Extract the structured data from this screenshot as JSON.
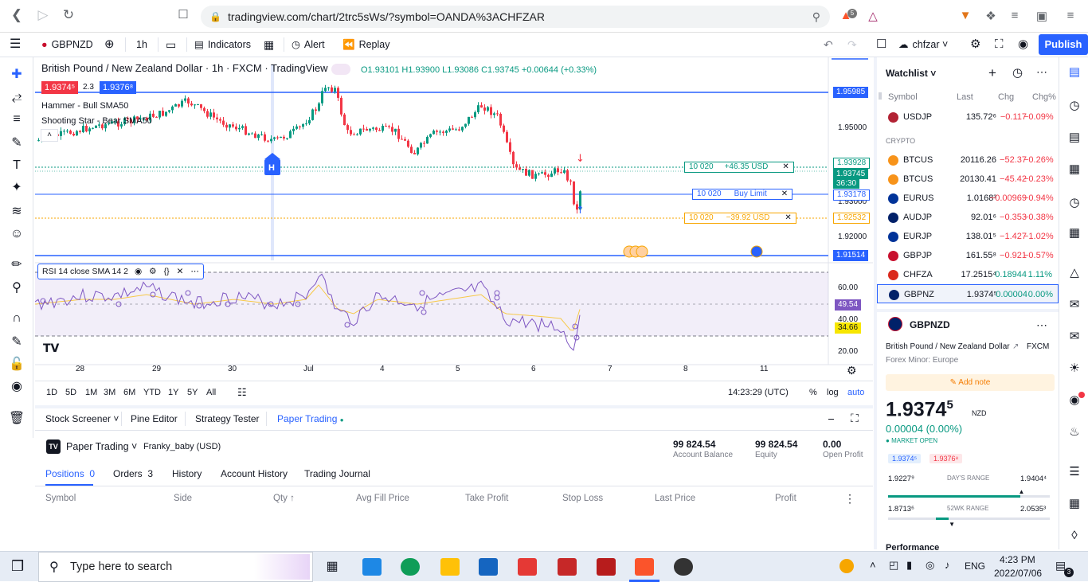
{
  "browser": {
    "url": "tradingview.com/chart/2trc5sWs/?symbol=OANDA%3ACHFZAR",
    "badge_count": "5"
  },
  "toolbar": {
    "symbol": "GBPNZD",
    "interval": "1h",
    "indicators": "Indicators",
    "alert": "Alert",
    "replay": "Replay",
    "layout_name": "chfzar",
    "publish": "Publish"
  },
  "chart": {
    "title": "British Pound / New Zealand Dollar · 1h · FXCM · TradingView",
    "ohlc": "O1.93101  H1.93900  L1.93086  C1.93745  +0.00644 (+0.33%)",
    "bid": "1.9374⁵",
    "spread": "2.3",
    "ask": "1.9376⁸",
    "ind1": "Hammer - Bull SMA50",
    "ind2": "Shooting Star - Bear SMA50",
    "marker_h": "H",
    "price_axis": [
      "1.95000",
      "1.93000",
      "1.92000"
    ],
    "line_prices": {
      "top": "1.95985",
      "mid_tp": "1.93928",
      "current": "1.93745",
      "countdown": "36:30",
      "limit": "1.93178",
      "sl": "1.92532",
      "bottom": "1.91514"
    },
    "orders": {
      "tp_qty": "10 020",
      "tp_label": "+46.35 USD",
      "lim_qty": "10 020",
      "lim_label": "Buy Limit",
      "sl_qty": "10 020",
      "sl_label": "−39.92 USD"
    },
    "rsi_label": "RSI 14 close SMA 14 2",
    "rsi_axis": [
      "60.00",
      "40.00",
      "20.00"
    ],
    "rsi_value": "49.54",
    "rsi_sma": "34.66",
    "time_axis": [
      "28",
      "29",
      "30",
      "Jul",
      "4",
      "5",
      "6",
      "7",
      "8",
      "11"
    ]
  },
  "ranges": {
    "buttons": [
      "1D",
      "5D",
      "1M",
      "3M",
      "6M",
      "YTD",
      "1Y",
      "5Y",
      "All"
    ],
    "clock": "14:23:29 (UTC)",
    "pct": "%",
    "log": "log",
    "auto": "auto"
  },
  "bottom": {
    "tabs": [
      "Stock Screener",
      "Pine Editor",
      "Strategy Tester",
      "Paper Trading"
    ],
    "broker": "Paper Trading",
    "account": "Franky_baby (USD)",
    "balance": "99 824.54",
    "balance_label": "Account Balance",
    "equity": "99 824.54",
    "equity_label": "Equity",
    "open_profit": "0.00",
    "open_profit_label": "Open Profit",
    "subtabs": {
      "positions": "Positions",
      "positions_count": "0",
      "orders": "Orders",
      "orders_count": "3",
      "history": "History",
      "account_history": "Account History",
      "journal": "Trading Journal"
    },
    "columns": [
      "Symbol",
      "Side",
      "Qty ↑",
      "Avg Fill Price",
      "Take Profit",
      "Stop Loss",
      "Last Price",
      "Profit"
    ]
  },
  "watchlist": {
    "title": "Watchlist",
    "headers": {
      "symbol": "Symbol",
      "last": "Last",
      "chg": "Chg",
      "chgp": "Chg%"
    },
    "section": "CRYPTO",
    "rows": [
      {
        "symbol": "USDJP",
        "last": "135.72⁶",
        "chg": "−0.117",
        "chgp": "−0.09%",
        "dir": "down",
        "color": "#b22234"
      },
      {
        "symbol": "BTCUS",
        "last": "20116.26",
        "chg": "−52.37",
        "chgp": "−0.26%",
        "dir": "down",
        "color": "#f7931a"
      },
      {
        "symbol": "BTCUS",
        "last": "20130.41",
        "chg": "−45.42",
        "chgp": "−0.23%",
        "dir": "down",
        "color": "#f7931a"
      },
      {
        "symbol": "EURUS",
        "last": "1.0168³",
        "chg": "−0.00969",
        "chgp": "−0.94%",
        "dir": "down",
        "color": "#003399"
      },
      {
        "symbol": "AUDJP",
        "last": "92.01⁶",
        "chg": "−0.353",
        "chgp": "−0.38%",
        "dir": "down",
        "color": "#012169"
      },
      {
        "symbol": "EURJP",
        "last": "138.01⁵",
        "chg": "−1.427",
        "chgp": "−1.02%",
        "dir": "down",
        "color": "#003399"
      },
      {
        "symbol": "GBPJP",
        "last": "161.55⁸",
        "chg": "−0.921",
        "chgp": "−0.57%",
        "dir": "down",
        "color": "#c8102e"
      },
      {
        "symbol": "CHFZA",
        "last": "17.2515⁴",
        "chg": "0.18944",
        "chgp": "1.11%",
        "dir": "up",
        "color": "#da291c"
      },
      {
        "symbol": "GBPNZ",
        "last": "1.9374⁵",
        "chg": "0.00004",
        "chgp": "0.00%",
        "dir": "up",
        "color": "#012169"
      }
    ],
    "detail": {
      "symbol": "GBPNZD",
      "name": "British Pound / New Zealand Dollar",
      "exchange": "FXCM",
      "category": "Forex Minor: Europe",
      "add_note": "Add note",
      "price": "1.9374",
      "price_sup": "5",
      "currency": "NZD",
      "change": "0.00004 (0.00%)",
      "market": "MARKET OPEN",
      "bid": "1.9374⁵",
      "ask": "1.9376⁸",
      "day_low": "1.9227⁹",
      "day_label": "DAY'S RANGE",
      "day_high": "1.9404⁴",
      "wk_low": "1.8713⁶",
      "wk_label": "52WK RANGE",
      "wk_high": "2.0535³",
      "day_range_pos": 0.82,
      "wk_range_pos": 0.39,
      "performance": "Performance"
    }
  },
  "taskbar": {
    "search": "Type here to search",
    "lang": "ENG",
    "time": "4:23 PM",
    "date": "2022/07/06",
    "notif": "3"
  }
}
